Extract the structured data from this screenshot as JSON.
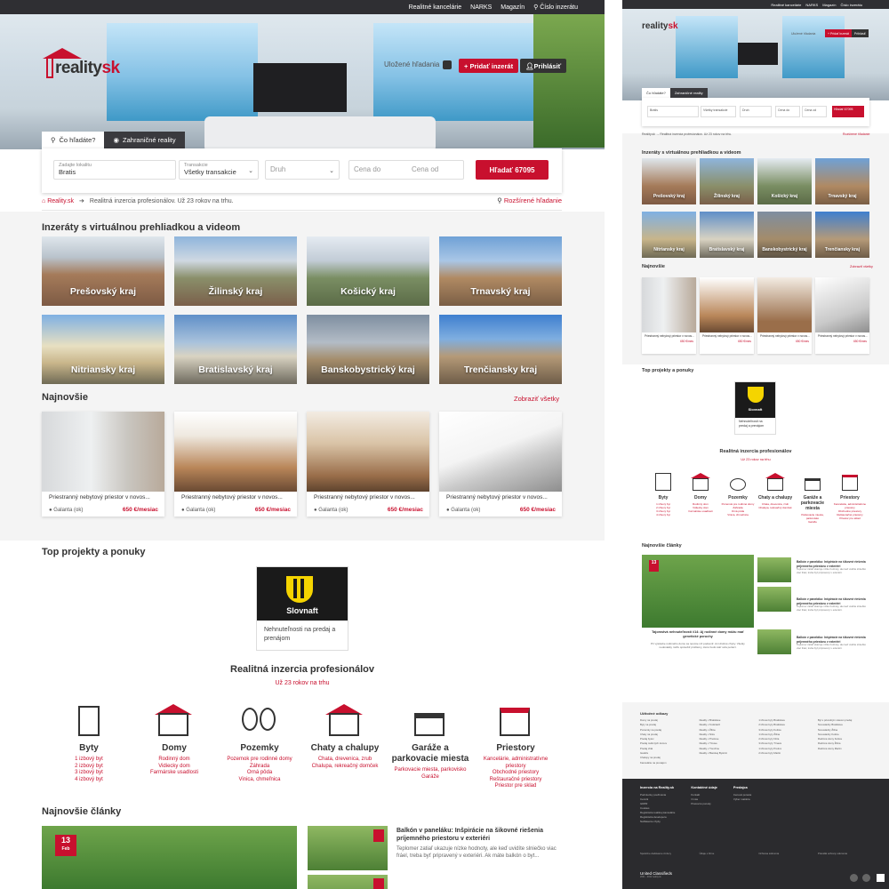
{
  "topnav": {
    "items": [
      "Realitné kancelárie",
      "NARKS",
      "Magazín"
    ],
    "search_number": "Číslo inzerátu"
  },
  "brand": {
    "logo_main": "reality",
    "logo_accent": "sk"
  },
  "header": {
    "saved_searches": "Uložené hľadania",
    "add_listing": "+ Pridať inzerát",
    "login": "Prihlásiť"
  },
  "search": {
    "tabs": [
      {
        "label": "Čo hľadáte?"
      },
      {
        "label": "Zahraničné reality"
      }
    ],
    "location_label": "Zadajte lokalitu",
    "location_value": "Bratis",
    "transaction_label": "Transakcie",
    "transaction_value": "Všetky transakcie",
    "type_placeholder": "Druh",
    "price_from": "Cena do",
    "price_to": "Cena od",
    "submit": "Hľadať 67095"
  },
  "breadcrumb": {
    "home": "Reality.sk",
    "current": "Realitná inzercia profesionálov. Už 23 rokov na trhu.",
    "advanced": "Rozšírené hľadanie"
  },
  "virtual": {
    "title": "Inzeráty s virtuálnou prehliadkou a videom",
    "regions": [
      "Prešovský kraj",
      "Žilinský kraj",
      "Košický kraj",
      "Trnavský kraj",
      "Nitriansky kraj",
      "Bratislavský kraj",
      "Banskobystrický kraj",
      "Trenčiansky kraj"
    ]
  },
  "newest": {
    "title": "Najnovšie",
    "show_all": "Zobraziť všetky",
    "cards": [
      {
        "title": "Priestranný nebytový priestor v novos...",
        "location": "Galanta (ok)",
        "price": "650 €/mesiac"
      },
      {
        "title": "Priestranný nebytový priestor v novos...",
        "location": "Galanta (ok)",
        "price": "650 €/mesiac"
      },
      {
        "title": "Priestranný nebytový priestor v novos...",
        "location": "Galanta (ok)",
        "price": "650 €/mesiac"
      },
      {
        "title": "Priestranný nebytový priestor v novos...",
        "location": "Galanta (ok)",
        "price": "650 €/mesiac"
      }
    ]
  },
  "top": {
    "title": "Top projekty a ponuky",
    "brand": "Slovnaft",
    "desc": "Nehnuteľnosti na predaj a prenájom"
  },
  "prof": {
    "title": "Realitná inzercia profesionálov",
    "subtitle": "Už 23 rokov na trhu",
    "cats": [
      {
        "name": "Byty",
        "sub": "1 izbový byt\n2 izbový byt\n3 izbový byt\n4 izbový byt"
      },
      {
        "name": "Domy",
        "sub": "Rodinný dom\nVidiecky dom\nFarmárske usadlosti"
      },
      {
        "name": "Pozemky",
        "sub": "Pozemok pre rodinné domy\nZáhrada\nOrná pôda\nVinica, chmeľnica"
      },
      {
        "name": "Chaty a chalupy",
        "sub": "Chata, drevenica, zrub\nChalupa, rekreačný domček"
      },
      {
        "name": "Garáže a parkovacie miesta",
        "sub": "Parkovacie miesta, parkovisko\nGaráže"
      },
      {
        "name": "Priestory",
        "sub": "Kancelárie, administratívne priestory\nObchodné priestory\nReštauračné priestory\nPriestor pre sklad"
      }
    ]
  },
  "articles": {
    "title": "Najnovšie články",
    "big_date": "13",
    "big_month": "Feb",
    "side_date": "13",
    "side_title": "Balkón v paneláku: Inšpirácie na šikovné riešenia príjemného priestoru v exteriéri",
    "side_text": "Teplomer zatiaľ ukazuje nízke hodnoty, ale keď uvidíte slniečko viac fráel, treba byť pripravený v exteriéri. Ak máte balkón o byt..."
  },
  "right": {
    "topnav": [
      "Realitné kancelárie",
      "NARKS",
      "Magazín",
      "Číslo inzerátu"
    ],
    "saved": "Uložené hľadania",
    "add": "+ Pridať inzerát",
    "login": "Prihlásiť",
    "tabs": [
      "Čo hľadáte?",
      "Zahraničné reality"
    ],
    "loc": "Bratis",
    "trans": "Všetky transakcie",
    "druh": "Druh",
    "cena_do": "Cena do",
    "cena_od": "Cena od",
    "submit": "Hľadať 67095",
    "crumb": "Reality.sk  →  Realitná inzercia profesionálov. Už 23 rokov na trhu.",
    "adv": "Rozšírené hľadanie",
    "virtual_title": "Inzeráty s virtuálnou prehliadkou a videom",
    "newest_title": "Najnovšie",
    "show_all": "Zobraziť všetky",
    "card_title": "Priestranný nebytový priestor v novos...",
    "card_loc": "Galanta (ok)",
    "card_price": "650 €/mes",
    "top_title": "Top projekty a ponuky",
    "slovnaft": "Slovnaft",
    "slovnaft_desc": "Nehnuteľnosti na predaj a prenájom",
    "prof_title": "Realitná inzercia profesionálov",
    "prof_sub": "Už 23 rokov na trhu",
    "articles_title": "Najnovšie články",
    "big_article_title": "Tajomstvá nehnuteľností #14: Aj rodinné domy môžu mať genetické poruchy",
    "big_article_text": "Pri výstavbe rodinného domu sa nesmie nič podceniť. Ani drobné chyby. Všetky nedostatky môžu spôsobiť problémy, ktoré budú stáť veľa peňazí.",
    "small_article_title": "Balkón v paneláku: Inšpirácie na šikovné riešenia príjemného priestoru v exteriéri",
    "small_article_text": "Teplomer zatiaľ ukazuje nízke hodnoty, ale keď uvidíte slniečko viac fráel, treba byť pripravený v exteriéri.",
    "footer_title": "Užitočné odkazy",
    "footer_cols": [
      [
        "Domy na predaj",
        "Byty na predaj",
        "Pozemky na predaj",
        "Chaty na predaj",
        "Predaj bytov",
        "Predaj rodinných domov",
        "Predaj chát",
        "Garáže",
        "Chalupy na predaj",
        "Kancelárie na prenájom"
      ],
      [
        "Reality v Bratislave",
        "Reality v Košiciach",
        "Reality v Žiline",
        "Reality v Nitre",
        "Reality v Prešove",
        "Reality v Trnave",
        "Reality v Trenčíne",
        "Reality v Banskej Bystrici"
      ],
      [
        "1 izbové byty Bratislava",
        "2 izbové byty Bratislava",
        "3 izbové byty Košice",
        "1 izbové byty Žilina",
        "2 izbové byty Nitra",
        "3 izbové byty Trnava",
        "1 izbové byty Prešov",
        "2 izbové byty Martin"
      ],
      [
        "Byt s pôvodným stavom predaj",
        "Novostavby Bratislava",
        "Novostavby Žilina",
        "Novostavby Košice",
        "Rodinné domy Košice",
        "Rodinné domy Žilina",
        "Rodinné domy Martin"
      ]
    ],
    "dark_cols": [
      {
        "hd": "Inzercia na Reality.sk",
        "items": [
          "Podmienky používania",
          "Cenník",
          "GDPR",
          "Cookies",
          "Registrácia realitnej kancelárie",
          "Registrácia developera",
          "Nahlásenie chyby"
        ]
      },
      {
        "hd": "Kontaktné údaje",
        "items": [
          "Kontakt",
          "O nás",
          "Pracovné ponuky"
        ]
      },
      {
        "hd": "Predajca",
        "items": [
          "Cenová ponuka",
          "Výber makléra"
        ]
      }
    ],
    "legal": [
      "Spoločne dodávame zmluvy",
      "Údaje o firme",
      "Ochrana súkromia",
      "Pravidlá ochrany súkromia"
    ],
    "uc": "United Classifieds",
    "uc_sub": "2001 - 2022 reality.sk"
  },
  "colors": {
    "accent": "#c8102e",
    "dark": "#2f2f33",
    "bg_gray": "#f4f4f4"
  }
}
